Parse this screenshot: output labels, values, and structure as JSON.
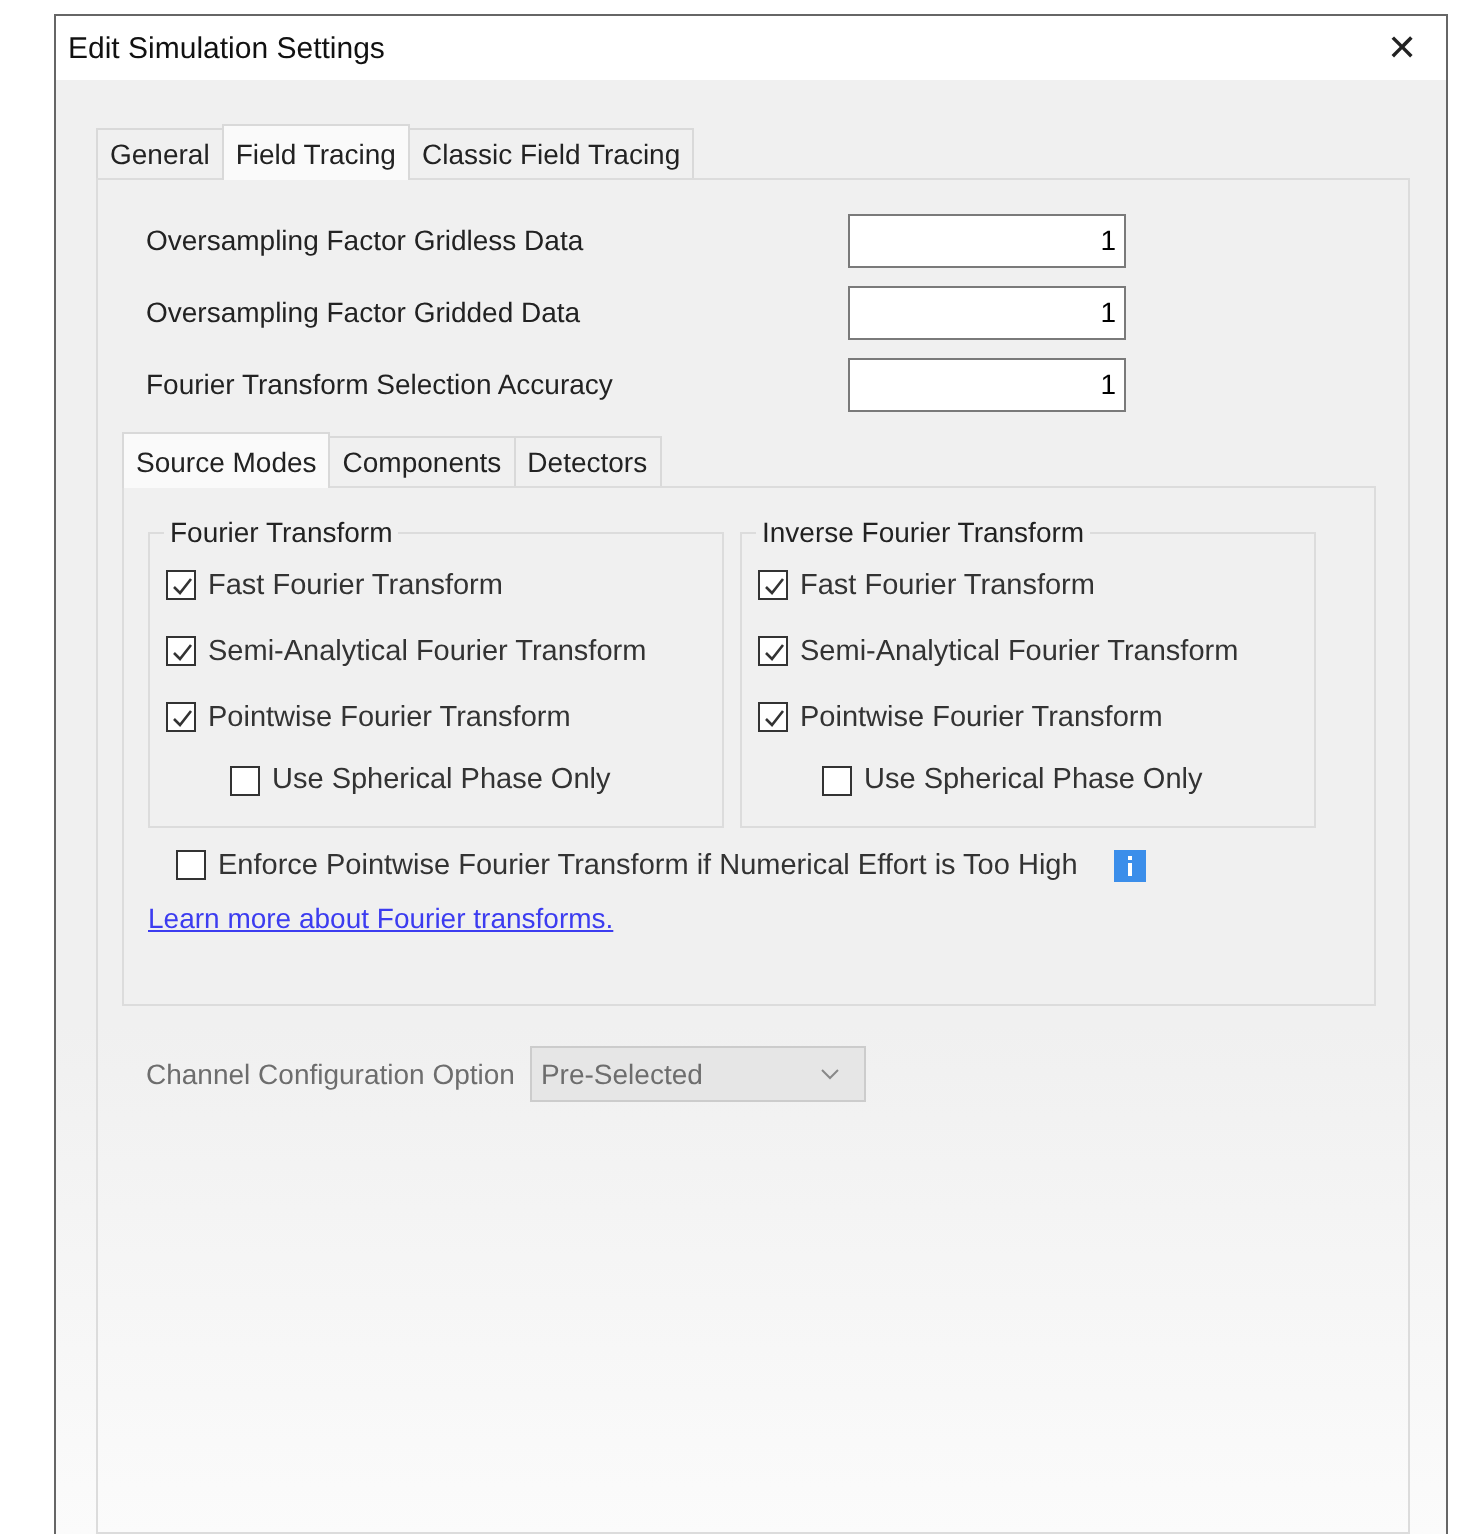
{
  "window": {
    "title": "Edit Simulation Settings",
    "close": "✕"
  },
  "tabs": [
    {
      "label": "General",
      "selected": false
    },
    {
      "label": "Field Tracing",
      "selected": true
    },
    {
      "label": "Classic Field Tracing",
      "selected": false
    }
  ],
  "fields": [
    {
      "label": "Oversampling Factor Gridless Data",
      "value": "1"
    },
    {
      "label": "Oversampling Factor Gridded Data",
      "value": "1"
    },
    {
      "label": "Fourier Transform Selection Accuracy",
      "value": "1"
    }
  ],
  "subtabs": [
    {
      "label": "Source Modes",
      "selected": true
    },
    {
      "label": "Components",
      "selected": false
    },
    {
      "label": "Detectors",
      "selected": false
    }
  ],
  "groups": [
    {
      "title": "Fourier Transform",
      "options": [
        {
          "label": "Fast Fourier Transform",
          "checked": true
        },
        {
          "label": "Semi-Analytical Fourier Transform",
          "checked": true
        },
        {
          "label": "Pointwise Fourier Transform",
          "checked": true,
          "children": [
            {
              "label": "Use Spherical Phase Only",
              "checked": false
            }
          ]
        }
      ]
    },
    {
      "title": "Inverse Fourier Transform",
      "options": [
        {
          "label": "Fast Fourier Transform",
          "checked": true
        },
        {
          "label": "Semi-Analytical Fourier Transform",
          "checked": true
        },
        {
          "label": "Pointwise Fourier Transform",
          "checked": true,
          "children": [
            {
              "label": "Use Spherical Phase Only",
              "checked": false
            }
          ]
        }
      ]
    }
  ],
  "enforce": {
    "label": "Enforce Pointwise Fourier Transform if Numerical Effort is Too High",
    "checked": false
  },
  "link": "Learn more about Fourier transforms.",
  "channel": {
    "label": "Channel Configuration Option",
    "value": "Pre-Selected",
    "disabled": true
  }
}
